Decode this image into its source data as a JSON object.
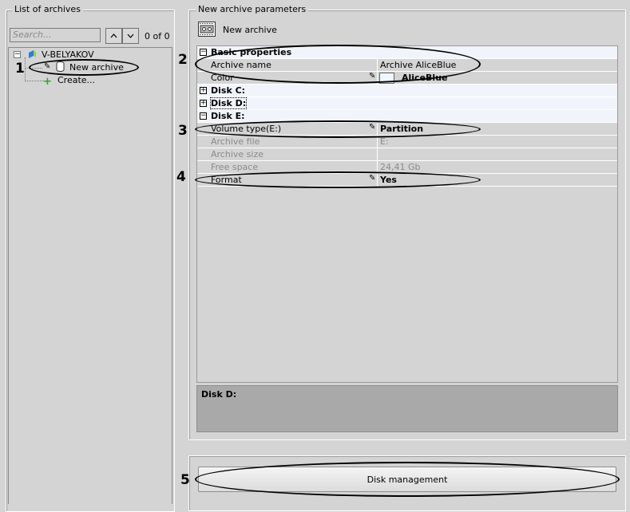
{
  "left_panel": {
    "legend": "List of archives",
    "search_placeholder": "Search...",
    "counter": "0 of 0",
    "tree": {
      "server": "V-BELYAKOV",
      "archive": "New archive",
      "create": "Create..."
    }
  },
  "right_panel": {
    "legend": "New archive parameters",
    "header_title": "New archive",
    "grid": {
      "basic": {
        "label": "Basic properties",
        "rows": [
          {
            "key": "Archive name",
            "value": "Archive AliceBlue"
          },
          {
            "key": "Color",
            "value": "AliceBlue"
          }
        ]
      },
      "disk_c": "Disk C:",
      "disk_d": "Disk D:",
      "disk_e": {
        "label": "Disk E:",
        "rows": [
          {
            "key": "Volume type(E:)",
            "value": "Partition"
          },
          {
            "key": "Archive file",
            "value": "E:"
          },
          {
            "key": "Archive size",
            "value": ""
          },
          {
            "key": "Free space",
            "value": "24,41 Gb"
          },
          {
            "key": "Format",
            "value": "Yes"
          }
        ]
      }
    },
    "description_title": "Disk D:",
    "disk_management_label": "Disk management"
  },
  "callouts": [
    "1",
    "2",
    "3",
    "4",
    "5"
  ],
  "colors": {
    "background": "#d4d4d4",
    "category_row": "#f1f5fb",
    "description_bg": "#a9a9a9",
    "swatch": "#f0f8ff"
  }
}
